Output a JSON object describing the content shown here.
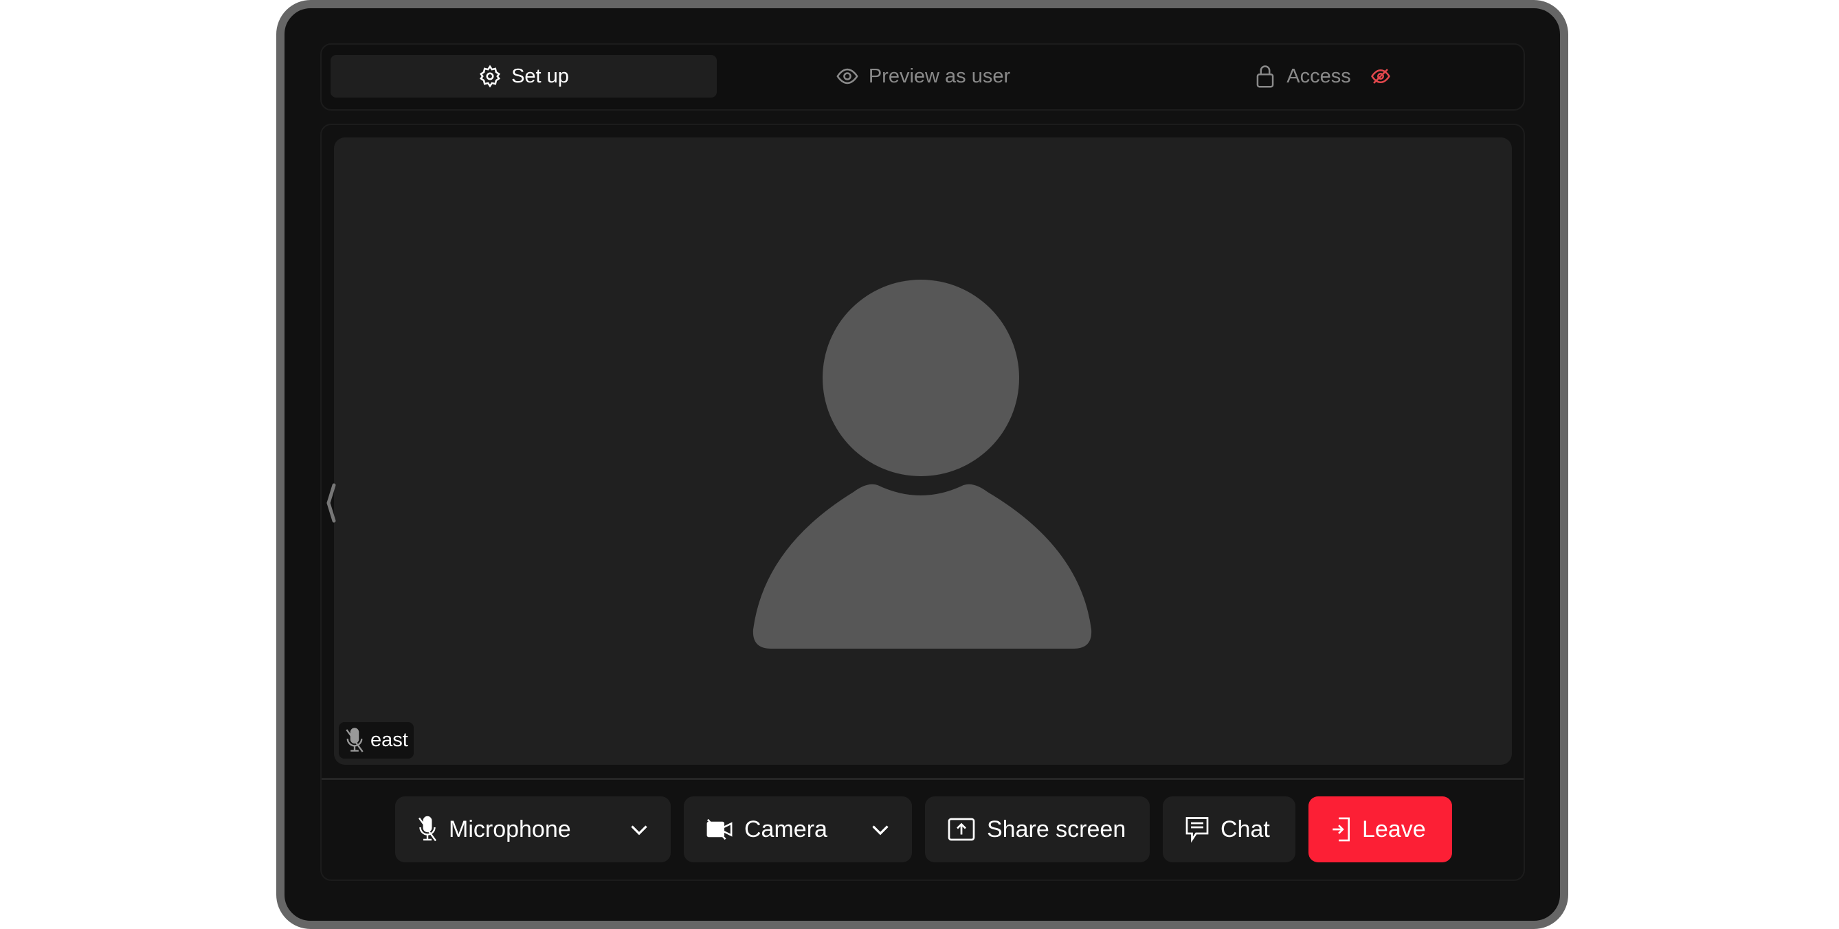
{
  "tabs": [
    {
      "label": "Set up",
      "icon": "gear-icon",
      "active": true
    },
    {
      "label": "Preview as user",
      "icon": "eye-icon",
      "active": false
    },
    {
      "label": "Access",
      "icon": "lock-icon",
      "badge_icon": "eye-off-icon",
      "badge_color": "#e5484d",
      "active": false
    }
  ],
  "participant": {
    "name": "east",
    "muted": true
  },
  "controls": {
    "microphone": "Microphone",
    "camera": "Camera",
    "share_screen": "Share screen",
    "chat": "Chat",
    "leave": "Leave"
  },
  "colors": {
    "leave": "#fc1f35",
    "background": "#111111",
    "video_tile": "#202020",
    "avatar": "#575757"
  }
}
